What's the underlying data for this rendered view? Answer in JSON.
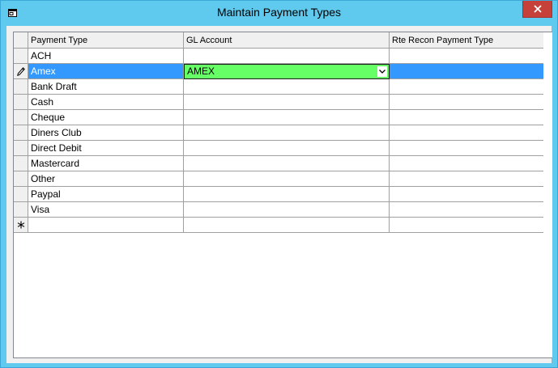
{
  "window": {
    "title": "Maintain Payment Types",
    "icon": "form-icon",
    "accent_color": "#5fc9ee",
    "close_color": "#c7413b"
  },
  "grid": {
    "columns": [
      "Payment Type",
      "GL Account",
      "Rte Recon Payment Type"
    ],
    "rows": [
      {
        "payment_type": "ACH",
        "gl_account": "",
        "rte_recon": ""
      },
      {
        "payment_type": "Amex",
        "gl_account": "AMEX",
        "rte_recon": "",
        "selected": true,
        "editing": true
      },
      {
        "payment_type": "Bank Draft",
        "gl_account": "",
        "rte_recon": ""
      },
      {
        "payment_type": "Cash",
        "gl_account": "",
        "rte_recon": ""
      },
      {
        "payment_type": "Cheque",
        "gl_account": "",
        "rte_recon": ""
      },
      {
        "payment_type": "Diners Club",
        "gl_account": "",
        "rte_recon": ""
      },
      {
        "payment_type": "Direct Debit",
        "gl_account": "",
        "rte_recon": ""
      },
      {
        "payment_type": "Mastercard",
        "gl_account": "",
        "rte_recon": ""
      },
      {
        "payment_type": "Other",
        "gl_account": "",
        "rte_recon": ""
      },
      {
        "payment_type": "Paypal",
        "gl_account": "",
        "rte_recon": ""
      },
      {
        "payment_type": "Visa",
        "gl_account": "",
        "rte_recon": ""
      }
    ],
    "selection_color": "#3399ff",
    "edit_color": "#66ff66",
    "row_indicator_icon": "pencil-icon",
    "new_row_icon": "asterisk-icon"
  }
}
